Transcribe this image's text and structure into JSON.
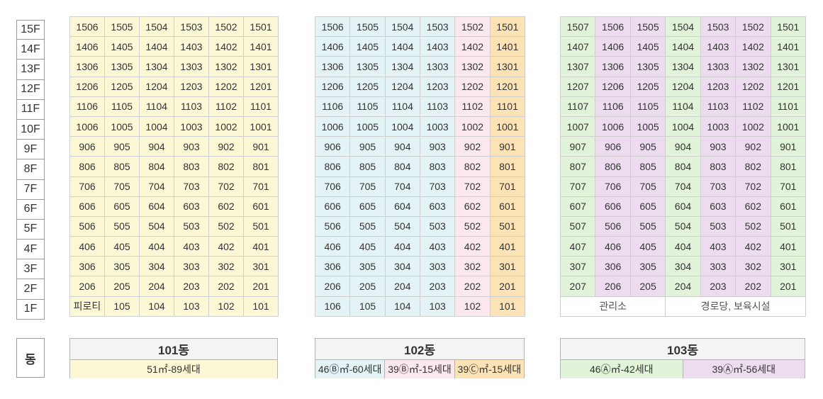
{
  "floors": [
    "15F",
    "14F",
    "13F",
    "12F",
    "11F",
    "10F",
    "9F",
    "8F",
    "7F",
    "6F",
    "5F",
    "4F",
    "3F",
    "2F",
    "1F"
  ],
  "dong_label": "동",
  "colors": {
    "yellow": "#fcf8d6",
    "blue": "#e4f3f6",
    "pink": "#fae8ee",
    "orange": "#fbe3b5",
    "green": "#e1f3d8",
    "purple": "#eddcf0"
  },
  "buildings": [
    {
      "id": "b101",
      "name": "101동",
      "units": [
        "06",
        "05",
        "04",
        "03",
        "02",
        "01"
      ],
      "col_types": [
        "yellow",
        "yellow",
        "yellow",
        "yellow",
        "yellow",
        "yellow"
      ],
      "ground": [
        "피로티",
        "105",
        "104",
        "103",
        "102",
        "101"
      ],
      "ground_span": "",
      "legend": [
        {
          "type": "yellow",
          "label": "51㎡-89세대"
        }
      ]
    },
    {
      "id": "b102",
      "name": "102동",
      "units": [
        "06",
        "05",
        "04",
        "03",
        "02",
        "01"
      ],
      "col_types": [
        "blue",
        "blue",
        "blue",
        "blue",
        "pink",
        "orange"
      ],
      "ground": [
        "106",
        "105",
        "104",
        "103",
        "102",
        "101"
      ],
      "ground_span": "",
      "legend": [
        {
          "type": "blue",
          "label": "46Ⓑ㎡-60세대"
        },
        {
          "type": "pink",
          "label": "39Ⓑ㎡-15세대"
        },
        {
          "type": "orange",
          "label": "39Ⓒ㎡-15세대"
        }
      ]
    },
    {
      "id": "b103",
      "name": "103동",
      "units": [
        "07",
        "06",
        "05",
        "04",
        "03",
        "02",
        "01"
      ],
      "col_types": [
        "green",
        "purple",
        "purple",
        "green",
        "purple",
        "purple",
        "green"
      ],
      "ground": [],
      "ground_span": [
        "관리소",
        "경로당, 보육시설"
      ],
      "legend": [
        {
          "type": "green",
          "label": "46Ⓐ㎡-42세대"
        },
        {
          "type": "purple",
          "label": "39Ⓐ㎡-56세대"
        }
      ]
    }
  ]
}
